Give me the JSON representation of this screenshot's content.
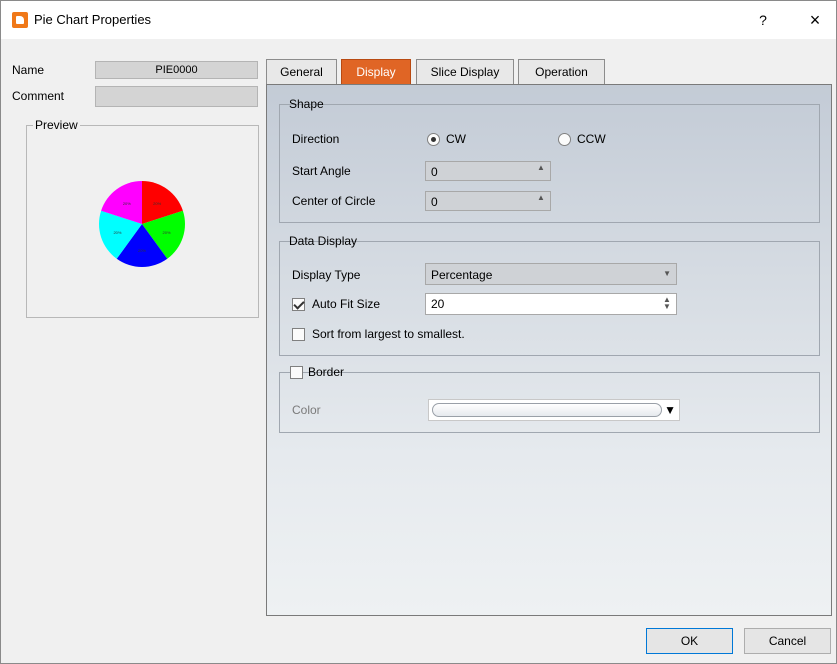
{
  "window": {
    "title": "Pie Chart Properties",
    "help": "?",
    "close": "×"
  },
  "left": {
    "name_label": "Name",
    "name_value": "PIE0000",
    "comment_label": "Comment",
    "comment_value": "",
    "preview_label": "Preview",
    "pie_labels": [
      "20%",
      "20%",
      "20%",
      "20%",
      "20%"
    ],
    "pie_colors": [
      "#ff0000",
      "#00ff00",
      "#0000ff",
      "#00ffff",
      "#ff00ff"
    ]
  },
  "tabs": [
    {
      "label": "General",
      "active": false
    },
    {
      "label": "Display",
      "active": true
    },
    {
      "label": "Slice Display",
      "active": false
    },
    {
      "label": "Operation",
      "active": false
    }
  ],
  "shape": {
    "legend": "Shape",
    "direction_label": "Direction",
    "cw_label": "CW",
    "ccw_label": "CCW",
    "direction_value": "CW",
    "start_angle_label": "Start Angle",
    "start_angle_value": "0",
    "center_label": "Center of Circle",
    "center_value": "0"
  },
  "data_display": {
    "legend": "Data Display",
    "display_type_label": "Display Type",
    "display_type_value": "Percentage",
    "auto_fit_label": "Auto Fit Size",
    "auto_fit_checked": true,
    "auto_fit_value": "20",
    "sort_label": "Sort from largest to smallest.",
    "sort_checked": false
  },
  "border": {
    "legend": "Border",
    "checked": false,
    "color_label": "Color"
  },
  "buttons": {
    "ok": "OK",
    "cancel": "Cancel"
  },
  "colors": {
    "accent_tab": "#e06525",
    "dialog_bg": "#f0f0f0"
  }
}
